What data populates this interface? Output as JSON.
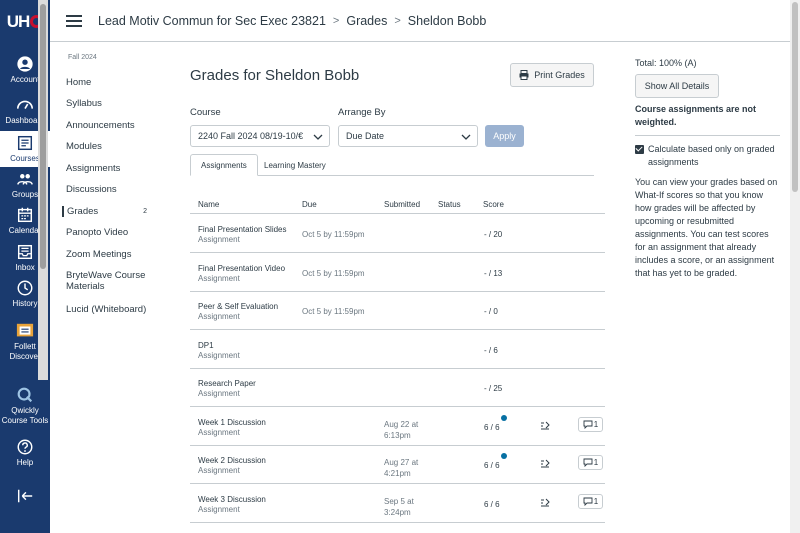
{
  "global_nav": {
    "logo_text": "UH",
    "items": [
      {
        "label": "Account",
        "icon": "account-icon"
      },
      {
        "label": "Dashboard",
        "icon": "dashboard-icon"
      },
      {
        "label": "Courses",
        "icon": "courses-icon",
        "active": true
      },
      {
        "label": "Groups",
        "icon": "groups-icon"
      },
      {
        "label": "Calendar",
        "icon": "calendar-icon"
      },
      {
        "label": "Inbox",
        "icon": "inbox-icon"
      },
      {
        "label": "History",
        "icon": "history-icon"
      },
      {
        "label": "Follett Discover",
        "icon": "follett-icon"
      },
      {
        "label": "Qwickly Course Tools",
        "icon": "qwickly-icon"
      },
      {
        "label": "Help",
        "icon": "help-icon"
      }
    ],
    "collapse_icon": "collapse-icon"
  },
  "header": {
    "course": "Lead Motiv Commun for Sec Exec 23821",
    "section": "Grades",
    "student": "Sheldon Bobb",
    "separator": ">"
  },
  "course_nav": {
    "term": "Fall 2024",
    "items": [
      {
        "label": "Home"
      },
      {
        "label": "Syllabus"
      },
      {
        "label": "Announcements"
      },
      {
        "label": "Modules"
      },
      {
        "label": "Assignments"
      },
      {
        "label": "Discussions"
      },
      {
        "label": "Grades",
        "active": true,
        "badge": "2"
      },
      {
        "label": "Panopto Video"
      },
      {
        "label": "Zoom Meetings"
      },
      {
        "label": "BryteWave Course Materials"
      },
      {
        "label": "Lucid (Whiteboard)"
      }
    ]
  },
  "main": {
    "title": "Grades for Sheldon Bobb",
    "print_label": "Print Grades",
    "course_label": "Course",
    "course_value": "2240 Fall 2024 08/19-10/€",
    "arrange_label": "Arrange By",
    "arrange_value": "Due Date",
    "apply_label": "Apply",
    "tabs": [
      "Assignments",
      "Learning Mastery"
    ],
    "columns": [
      "Name",
      "Due",
      "Submitted",
      "Status",
      "Score"
    ],
    "rows": [
      {
        "name": "Final Presentation Slides",
        "type": "Assignment",
        "due": "Oct 5 by 11:59pm",
        "submitted": "",
        "submitted2": "",
        "score": "- / 20"
      },
      {
        "name": "Final Presentation Video",
        "type": "Assignment",
        "due": "Oct 5 by 11:59pm",
        "submitted": "",
        "submitted2": "",
        "score": "- / 13"
      },
      {
        "name": "Peer & Self Evaluation",
        "type": "Assignment",
        "due": "Oct 5 by 11:59pm",
        "submitted": "",
        "submitted2": "",
        "score": "- / 0"
      },
      {
        "name": "DP1",
        "type": "Assignment",
        "due": "",
        "submitted": "",
        "submitted2": "",
        "score": "- / 6"
      },
      {
        "name": "Research Paper",
        "type": "Assignment",
        "due": "",
        "submitted": "",
        "submitted2": "",
        "score": "- / 25"
      },
      {
        "name": "Week 1 Discussion",
        "type": "Assignment",
        "due": "",
        "submitted": "Aug 22 at",
        "submitted2": "6:13pm",
        "score": "6 / 6",
        "dot": true,
        "comments": "1"
      },
      {
        "name": "Week 2 Discussion",
        "type": "Assignment",
        "due": "",
        "submitted": "Aug 27 at",
        "submitted2": "4:21pm",
        "score": "6 / 6",
        "dot": true,
        "comments": "1"
      },
      {
        "name": "Week 3 Discussion",
        "type": "Assignment",
        "due": "",
        "submitted": "Sep 5 at",
        "submitted2": "3:24pm",
        "score": "6 / 6",
        "dot": false,
        "comments": "1"
      }
    ]
  },
  "right": {
    "total": "Total: 100% (A)",
    "show_details": "Show All Details",
    "weight_note": "Course assignments are not weighted.",
    "calc_label": "Calculate based only on graded assignments",
    "calc_checked": true,
    "whatif_note": "You can view your grades based on What-If scores so that you know how grades will be affected by upcoming or resubmitted assignments. You can test scores for an assignment that already includes a score, or an assignment that has yet to be graded."
  }
}
